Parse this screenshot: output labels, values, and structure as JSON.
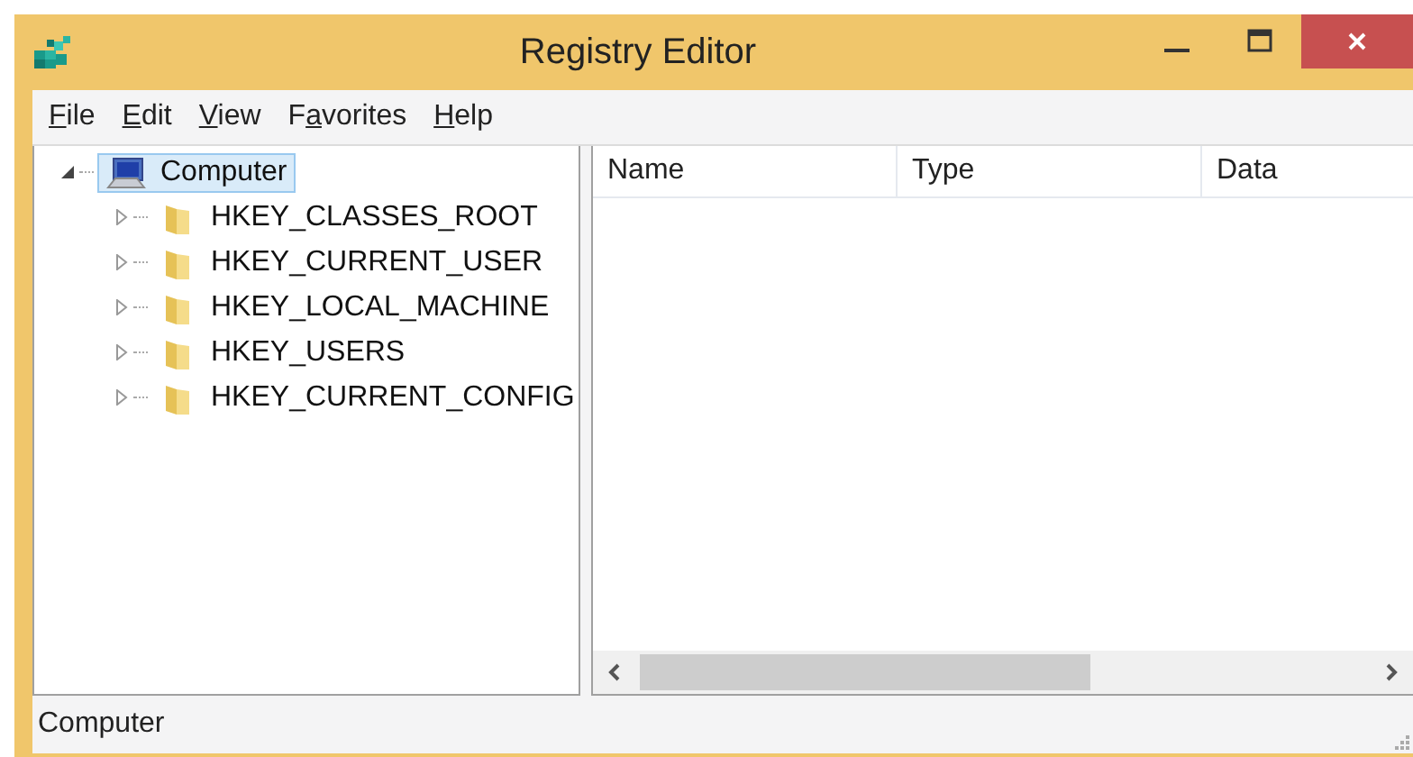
{
  "window": {
    "title": "Registry Editor"
  },
  "menu": [
    {
      "mnemonic": "F",
      "rest": "ile"
    },
    {
      "mnemonic": "E",
      "rest": "dit"
    },
    {
      "mnemonic": "V",
      "rest": "iew"
    },
    {
      "before": "F",
      "mnemonic": "a",
      "rest": "vorites"
    },
    {
      "mnemonic": "H",
      "rest": "elp"
    }
  ],
  "tree": [
    {
      "label": "Computer",
      "kind": "computer",
      "selected": true,
      "expanded": true,
      "children": [
        {
          "label": "HKEY_CLASSES_ROOT",
          "kind": "folder",
          "selected": false,
          "expanded": false
        },
        {
          "label": "HKEY_CURRENT_USER",
          "kind": "folder",
          "selected": false,
          "expanded": false
        },
        {
          "label": "HKEY_LOCAL_MACHINE",
          "kind": "folder",
          "selected": false,
          "expanded": false
        },
        {
          "label": "HKEY_USERS",
          "kind": "folder",
          "selected": false,
          "expanded": false
        },
        {
          "label": "HKEY_CURRENT_CONFIG",
          "kind": "folder",
          "selected": false,
          "expanded": false
        }
      ]
    }
  ],
  "list": {
    "columns": [
      "Name",
      "Type",
      "Data"
    ]
  },
  "status_bar": "Computer"
}
